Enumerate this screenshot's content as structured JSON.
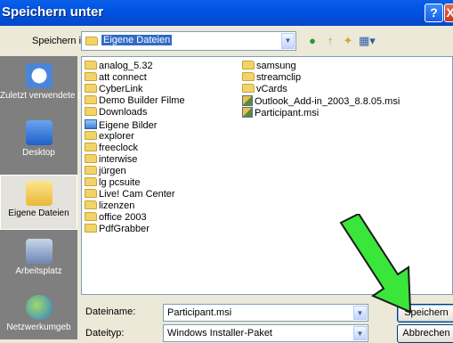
{
  "window": {
    "title": "Speichern unter",
    "help_label": "?",
    "close_label": "X"
  },
  "lookin": {
    "label": "Speichern in:",
    "value": "Eigene Dateien"
  },
  "places": [
    {
      "label": "Zuletzt verwendete D..."
    },
    {
      "label": "Desktop"
    },
    {
      "label": "Eigene Dateien"
    },
    {
      "label": "Arbeitsplatz"
    },
    {
      "label": "Netzwerkumgeb"
    }
  ],
  "files_col1": [
    {
      "name": "analog_5.32",
      "type": "folder"
    },
    {
      "name": "att connect",
      "type": "folder"
    },
    {
      "name": "CyberLink",
      "type": "folder"
    },
    {
      "name": "Demo Builder Filme",
      "type": "folder"
    },
    {
      "name": "Downloads",
      "type": "folder"
    },
    {
      "name": "Eigene Bilder",
      "type": "pics"
    },
    {
      "name": "explorer",
      "type": "folder"
    },
    {
      "name": "freeclock",
      "type": "folder"
    },
    {
      "name": "interwise",
      "type": "folder"
    },
    {
      "name": "jürgen",
      "type": "folder"
    },
    {
      "name": "lg pcsuite",
      "type": "folder"
    },
    {
      "name": "Live! Cam Center",
      "type": "folder"
    },
    {
      "name": "lizenzen",
      "type": "folder"
    },
    {
      "name": "office 2003",
      "type": "folder"
    },
    {
      "name": "PdfGrabber",
      "type": "folder"
    }
  ],
  "files_col2": [
    {
      "name": "samsung",
      "type": "folder"
    },
    {
      "name": "streamclip",
      "type": "folder"
    },
    {
      "name": "vCards",
      "type": "folder"
    },
    {
      "name": "Outlook_Add-in_2003_8.8.05.msi",
      "type": "msi"
    },
    {
      "name": "Participant.msi",
      "type": "msi"
    }
  ],
  "form": {
    "filename_label": "Dateiname:",
    "filename_value": "Participant.msi",
    "filetype_label": "Dateityp:",
    "filetype_value": "Windows Installer-Paket"
  },
  "buttons": {
    "save": "Speichern",
    "cancel": "Abbrechen"
  },
  "colors": {
    "annotation_arrow": "#39e639"
  }
}
